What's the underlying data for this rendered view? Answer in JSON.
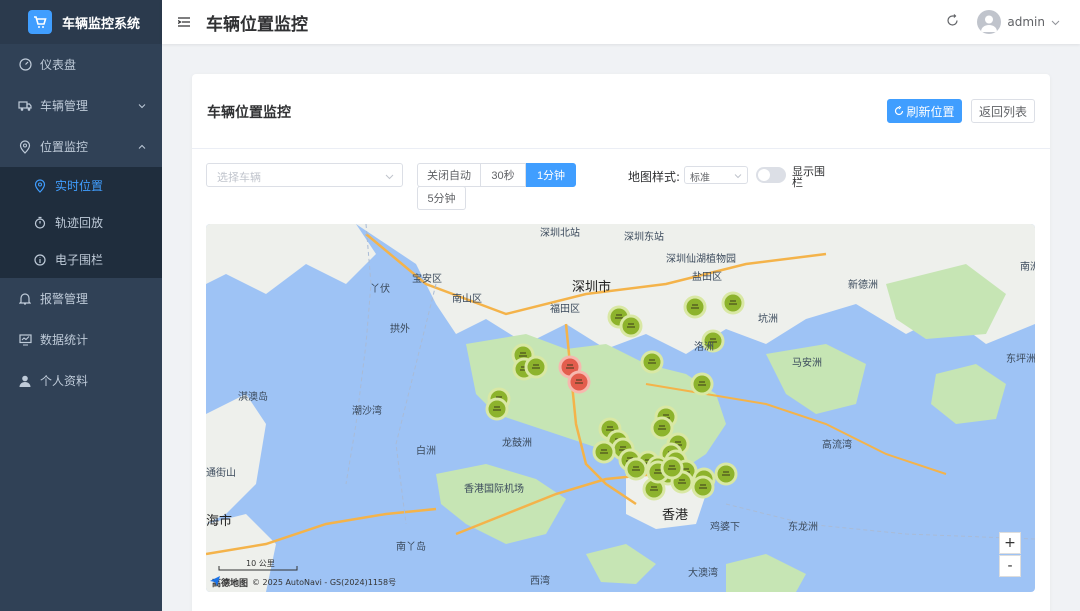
{
  "app": {
    "title": "车辆监控系统"
  },
  "sidebar": {
    "items": [
      {
        "label": "仪表盘"
      },
      {
        "label": "车辆管理"
      },
      {
        "label": "位置监控"
      },
      {
        "label": "报警管理"
      },
      {
        "label": "数据统计"
      },
      {
        "label": "个人资料"
      }
    ],
    "sub_items": [
      {
        "label": "实时位置",
        "active": true
      },
      {
        "label": "轨迹回放"
      },
      {
        "label": "电子围栏"
      }
    ]
  },
  "header": {
    "page_title": "车辆位置监控",
    "username": "admin"
  },
  "card": {
    "title": "车辆位置监控",
    "refresh_label": "刷新位置",
    "back_label": "返回列表"
  },
  "filters": {
    "vehicle_placeholder": "选择车辆",
    "refresh_options": [
      "关闭自动",
      "30秒",
      "1分钟",
      "5分钟"
    ],
    "refresh_selected": "1分钟",
    "map_style_label": "地图样式:",
    "map_style_value": "标准",
    "fence_toggle_label": "显示围栏",
    "fence_toggle_on": false
  },
  "map": {
    "labels": {
      "shenzhen_north": "深圳北站",
      "shenzhen_east": "深圳东站",
      "shenzhen": "深圳市",
      "xianhu": "深圳仙湖植物园",
      "yantian": "盐田区",
      "baoan": "宝安区",
      "nanshan": "南山区",
      "futian": "福田区",
      "yaqian": "丫伏",
      "pingzhou": "拱外",
      "qiao": "淇澳岛",
      "tsh": "潮沙湾",
      "bailingzhou": "白洲",
      "longgu": "龙鼓洲",
      "hkia": "香港国际机场",
      "hongkong": "香港",
      "zhuhai": "海市",
      "xiaomei": "新德洲",
      "dongping": "东坪洲",
      "ma": "马安洲",
      "gongzhou": "高流湾",
      "zhuhai2": "东龙洲",
      "luozhou": "洛洲",
      "xiwan": "西湾",
      "dachong": "大澳湾",
      "south_island": "南洲",
      "kwun": "坑洲",
      "lanma": "南丫岛",
      "pinghzhou": "蒲台洲",
      "chek": "鸡婆下",
      "nanzhou2": "南澳",
      "tongxi": "通街山",
      "lama": "东博寮"
    },
    "scale_label": "10 公里",
    "attribution": "© 2025 AutoNavi - GS(2024)1158号",
    "brand": "高德地图",
    "zoom_in": "+",
    "zoom_out": "-",
    "marker_count": 36
  },
  "colors": {
    "primary": "#409eff",
    "sidebar_bg": "#304156",
    "marker_green": "#8db32c",
    "marker_red": "#e35d4d"
  }
}
